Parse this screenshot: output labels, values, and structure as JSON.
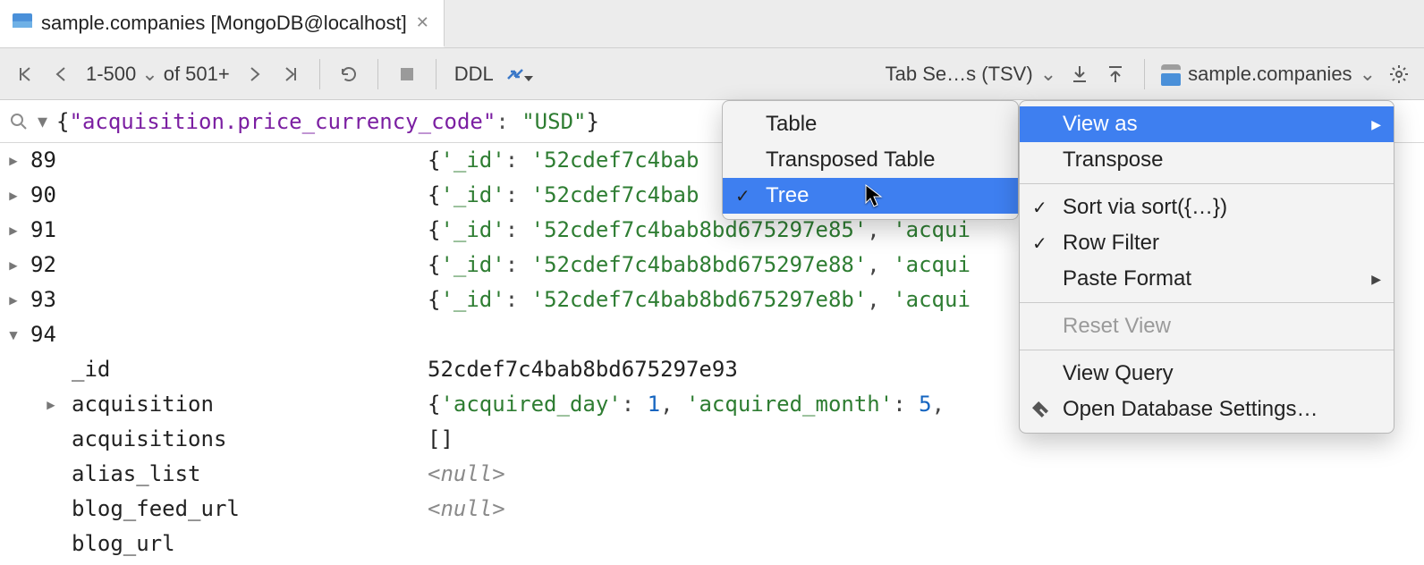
{
  "tab": {
    "title": "sample.companies [MongoDB@localhost]"
  },
  "toolbar": {
    "range": "1-500",
    "of_label": "of 501+",
    "ddl_label": "DDL",
    "format_label": "Tab Se…s (TSV)",
    "datasource_label": "sample.companies"
  },
  "filter": {
    "key": "\"acquisition.price_currency_code\"",
    "value": "\"USD\""
  },
  "rows": [
    {
      "n": "89",
      "id": "52cdef7c4bab"
    },
    {
      "n": "90",
      "id": "52cdef7c4bab"
    },
    {
      "n": "91",
      "id": "52cdef7c4bab8bd675297e85",
      "field": "acqui"
    },
    {
      "n": "92",
      "id": "52cdef7c4bab8bd675297e88",
      "field": "acqui"
    },
    {
      "n": "93",
      "id": "52cdef7c4bab8bd675297e8b",
      "field": "acqui"
    }
  ],
  "expanded": {
    "n": "94",
    "id_key": "_id",
    "id_val": "52cdef7c4bab8bd675297e93",
    "acq_key": "acquisition",
    "acq_val_prefix": "{'acquired_day': ",
    "acq_day": "1",
    "acq_mid": ", 'acquired_month': ",
    "acq_month": "5",
    "acq_suffix": ", ",
    "acqs_key": "acquisitions",
    "acqs_val": "[]",
    "alias_key": "alias_list",
    "blog_feed_key": "blog_feed_url",
    "blog_url_key": "blog_url",
    "null_label": "<null>"
  },
  "menu_sub": {
    "table": "Table",
    "transposed": "Transposed Table",
    "tree": "Tree"
  },
  "menu_main": {
    "view_as": "View as",
    "transpose": "Transpose",
    "sort": "Sort via sort({…})",
    "row_filter": "Row Filter",
    "paste_format": "Paste Format",
    "reset_view": "Reset View",
    "view_query": "View Query",
    "open_settings": "Open Database Settings…"
  }
}
